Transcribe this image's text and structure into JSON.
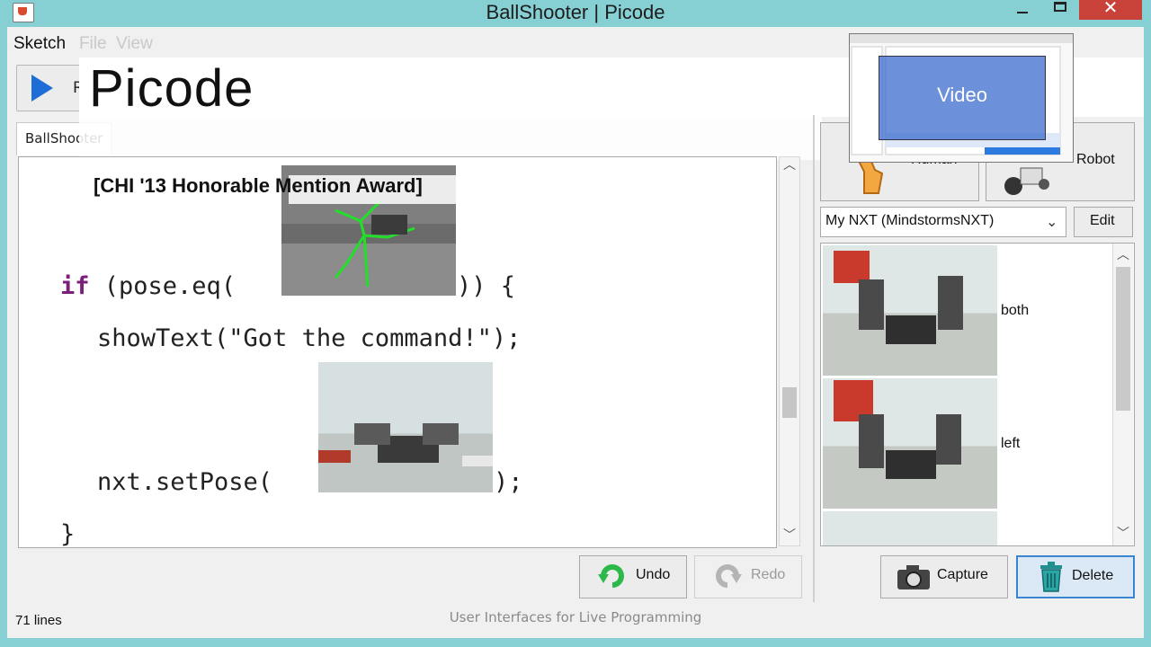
{
  "window": {
    "title": "BallShooter | Picode",
    "close_glyph": "✕"
  },
  "menu": {
    "sketch": "Sketch",
    "file": "File",
    "view": "View"
  },
  "toolbar": {
    "run_label": "R"
  },
  "banner": {
    "title": "Picode",
    "award": "[CHI '13 Honorable Mention Award]"
  },
  "editor": {
    "tab_label": "BallShooter",
    "line_if_kw": "if",
    "line_if_rest": " (pose.eq(",
    "line_if_end": ")) {",
    "line_show": "showText(\"Got the command!\");",
    "line_set": "nxt.setPose(",
    "line_set_end": ");",
    "line_close": "}"
  },
  "buttons": {
    "undo": "Undo",
    "redo": "Redo",
    "human": "Human",
    "robot": "Robot",
    "edit": "Edit",
    "capture": "Capture",
    "delete": "Delete"
  },
  "device_select": {
    "value": "My NXT (MindstormsNXT)"
  },
  "poses": [
    {
      "label": "both"
    },
    {
      "label": "left"
    }
  ],
  "status": {
    "lines": "71 lines"
  },
  "footer": {
    "caption": "User Interfaces for Live Programming"
  },
  "video": {
    "label": "Video"
  },
  "colors": {
    "title_bar": "#86cfd3",
    "keyword": "#7b1f7b",
    "run_blue": "#1f6ed8",
    "undo_green": "#2db84a",
    "close_red": "#c9423a",
    "delete_teal": "#1f8f8f"
  }
}
